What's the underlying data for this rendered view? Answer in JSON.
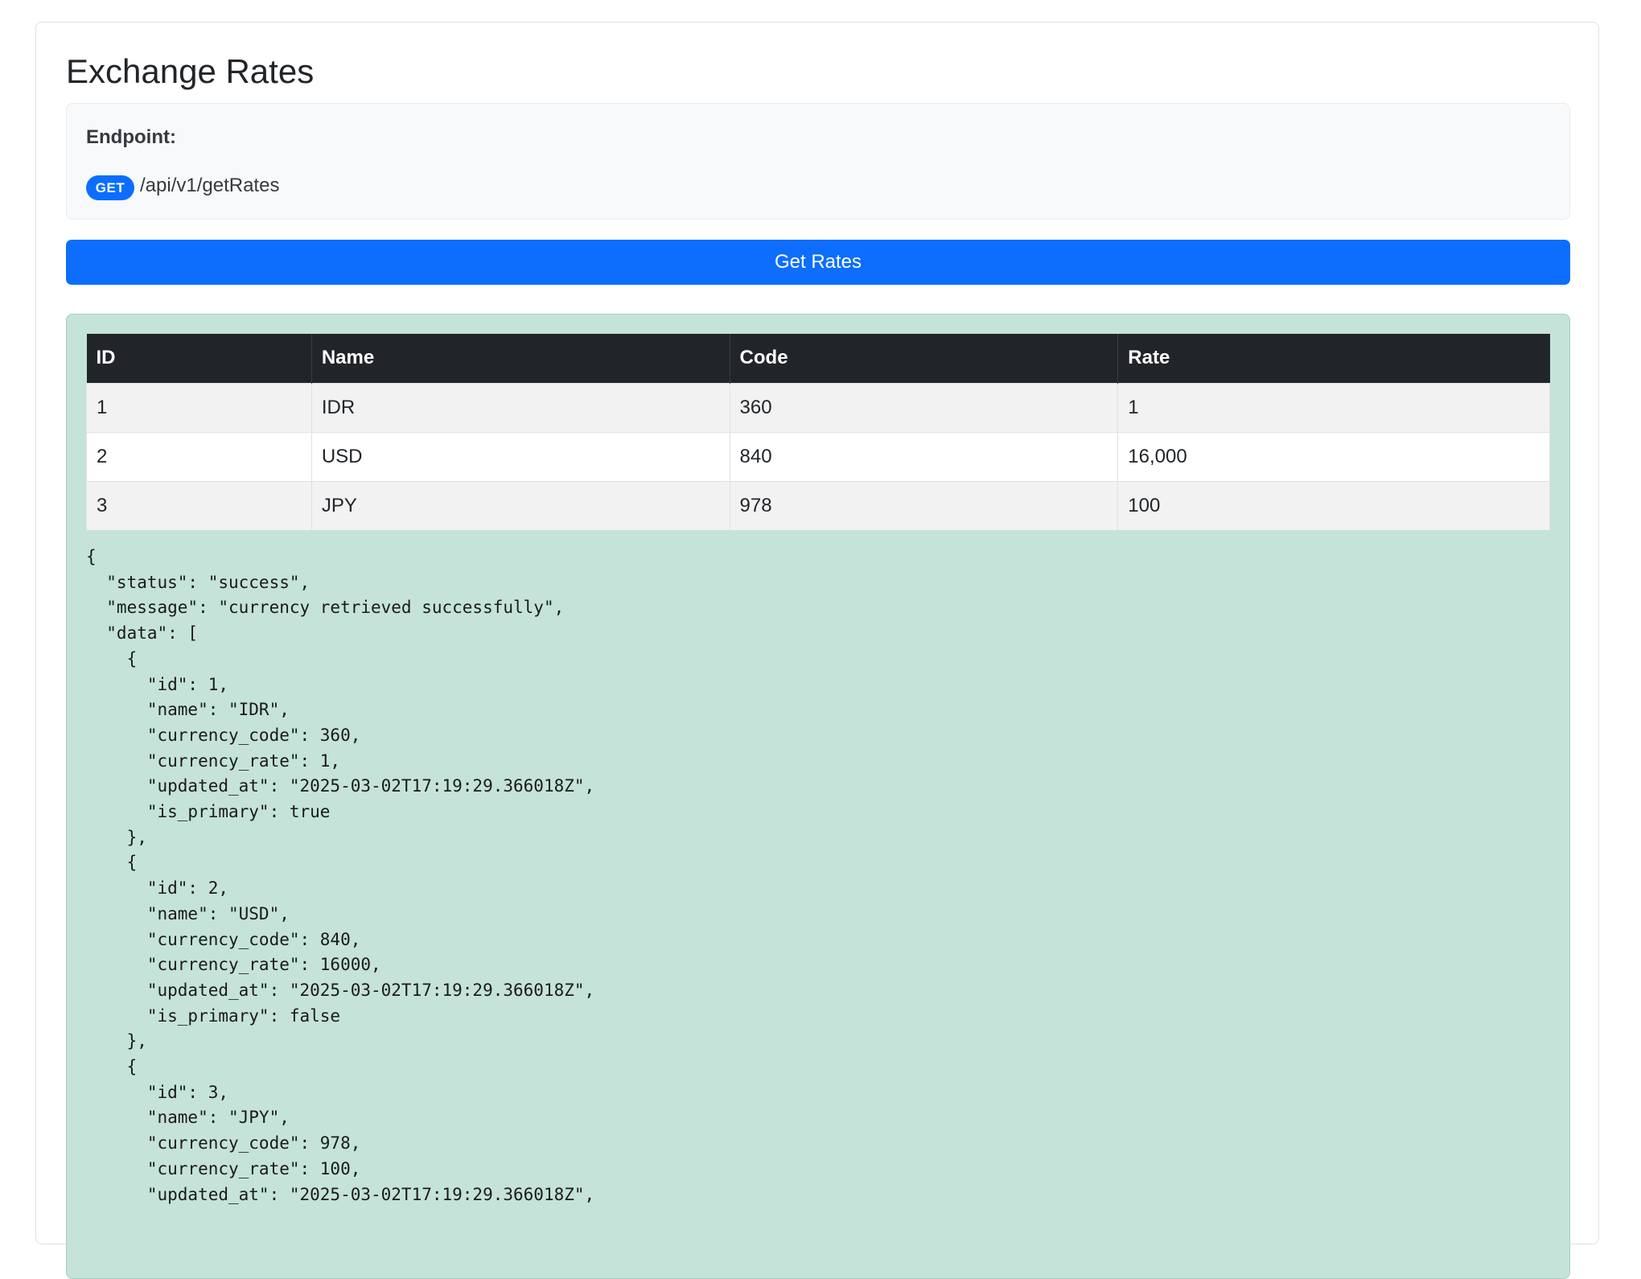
{
  "page": {
    "title": "Exchange Rates"
  },
  "endpoint": {
    "label": "Endpoint:",
    "method": "GET",
    "path": "/api/v1/getRates"
  },
  "actions": {
    "get_rates_label": "Get Rates"
  },
  "colors": {
    "primary": "#0d6efd",
    "table_header_bg": "#212529",
    "result_bg": "#c5e3d8",
    "endpoint_bg": "#f8f9fa"
  },
  "table": {
    "headers": [
      "ID",
      "Name",
      "Code",
      "Rate"
    ],
    "rows": [
      [
        "1",
        "IDR",
        "360",
        "1"
      ],
      [
        "2",
        "USD",
        "840",
        "16,000"
      ],
      [
        "3",
        "JPY",
        "978",
        "100"
      ]
    ]
  },
  "response": {
    "json_text": "{\n  \"status\": \"success\",\n  \"message\": \"currency retrieved successfully\",\n  \"data\": [\n    {\n      \"id\": 1,\n      \"name\": \"IDR\",\n      \"currency_code\": 360,\n      \"currency_rate\": 1,\n      \"updated_at\": \"2025-03-02T17:19:29.366018Z\",\n      \"is_primary\": true\n    },\n    {\n      \"id\": 2,\n      \"name\": \"USD\",\n      \"currency_code\": 840,\n      \"currency_rate\": 16000,\n      \"updated_at\": \"2025-03-02T17:19:29.366018Z\",\n      \"is_primary\": false\n    },\n    {\n      \"id\": 3,\n      \"name\": \"JPY\",\n      \"currency_code\": 978,\n      \"currency_rate\": 100,\n      \"updated_at\": \"2025-03-02T17:19:29.366018Z\","
  }
}
